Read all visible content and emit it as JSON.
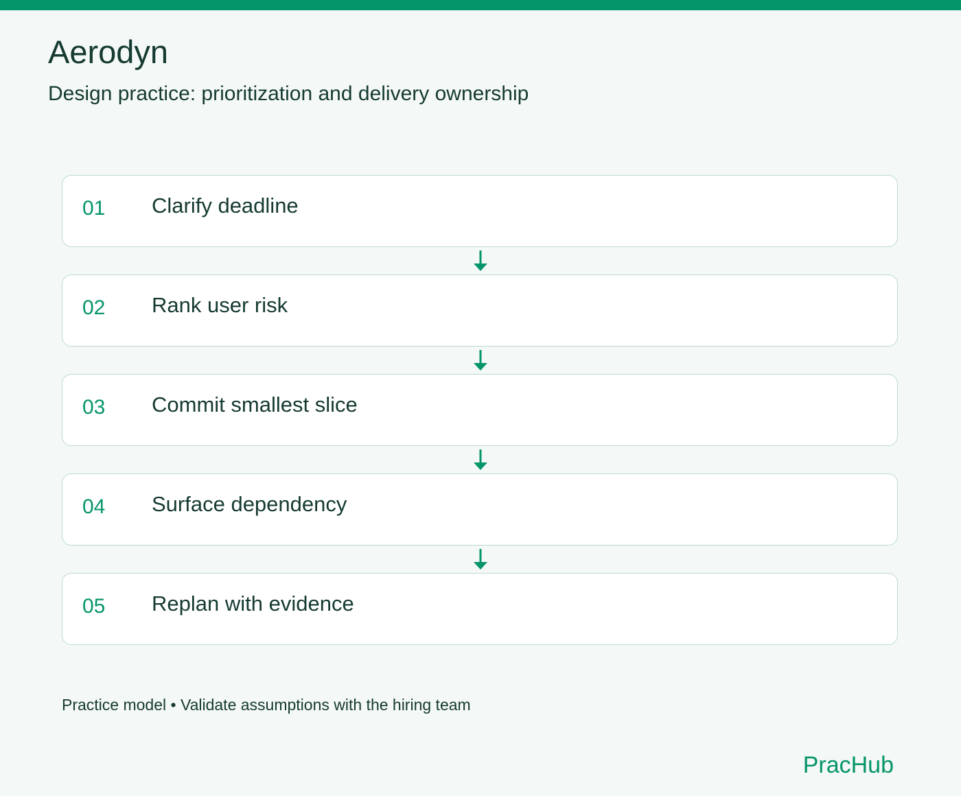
{
  "header": {
    "title": "Aerodyn",
    "subtitle": "Design practice: prioritization and delivery ownership"
  },
  "steps": [
    {
      "number": "01",
      "label": "Clarify deadline"
    },
    {
      "number": "02",
      "label": "Rank user risk"
    },
    {
      "number": "03",
      "label": "Commit smallest slice"
    },
    {
      "number": "04",
      "label": "Surface dependency"
    },
    {
      "number": "05",
      "label": "Replan with evidence"
    }
  ],
  "footer": {
    "note": "Practice model • Validate assumptions with the hiring team",
    "brand": "PracHub"
  },
  "colors": {
    "accent": "#05956a",
    "text": "#153a31",
    "card_border": "#bcdccf",
    "background": "#f4f8f6"
  },
  "icons": {
    "connector": "arrow-down-icon"
  }
}
